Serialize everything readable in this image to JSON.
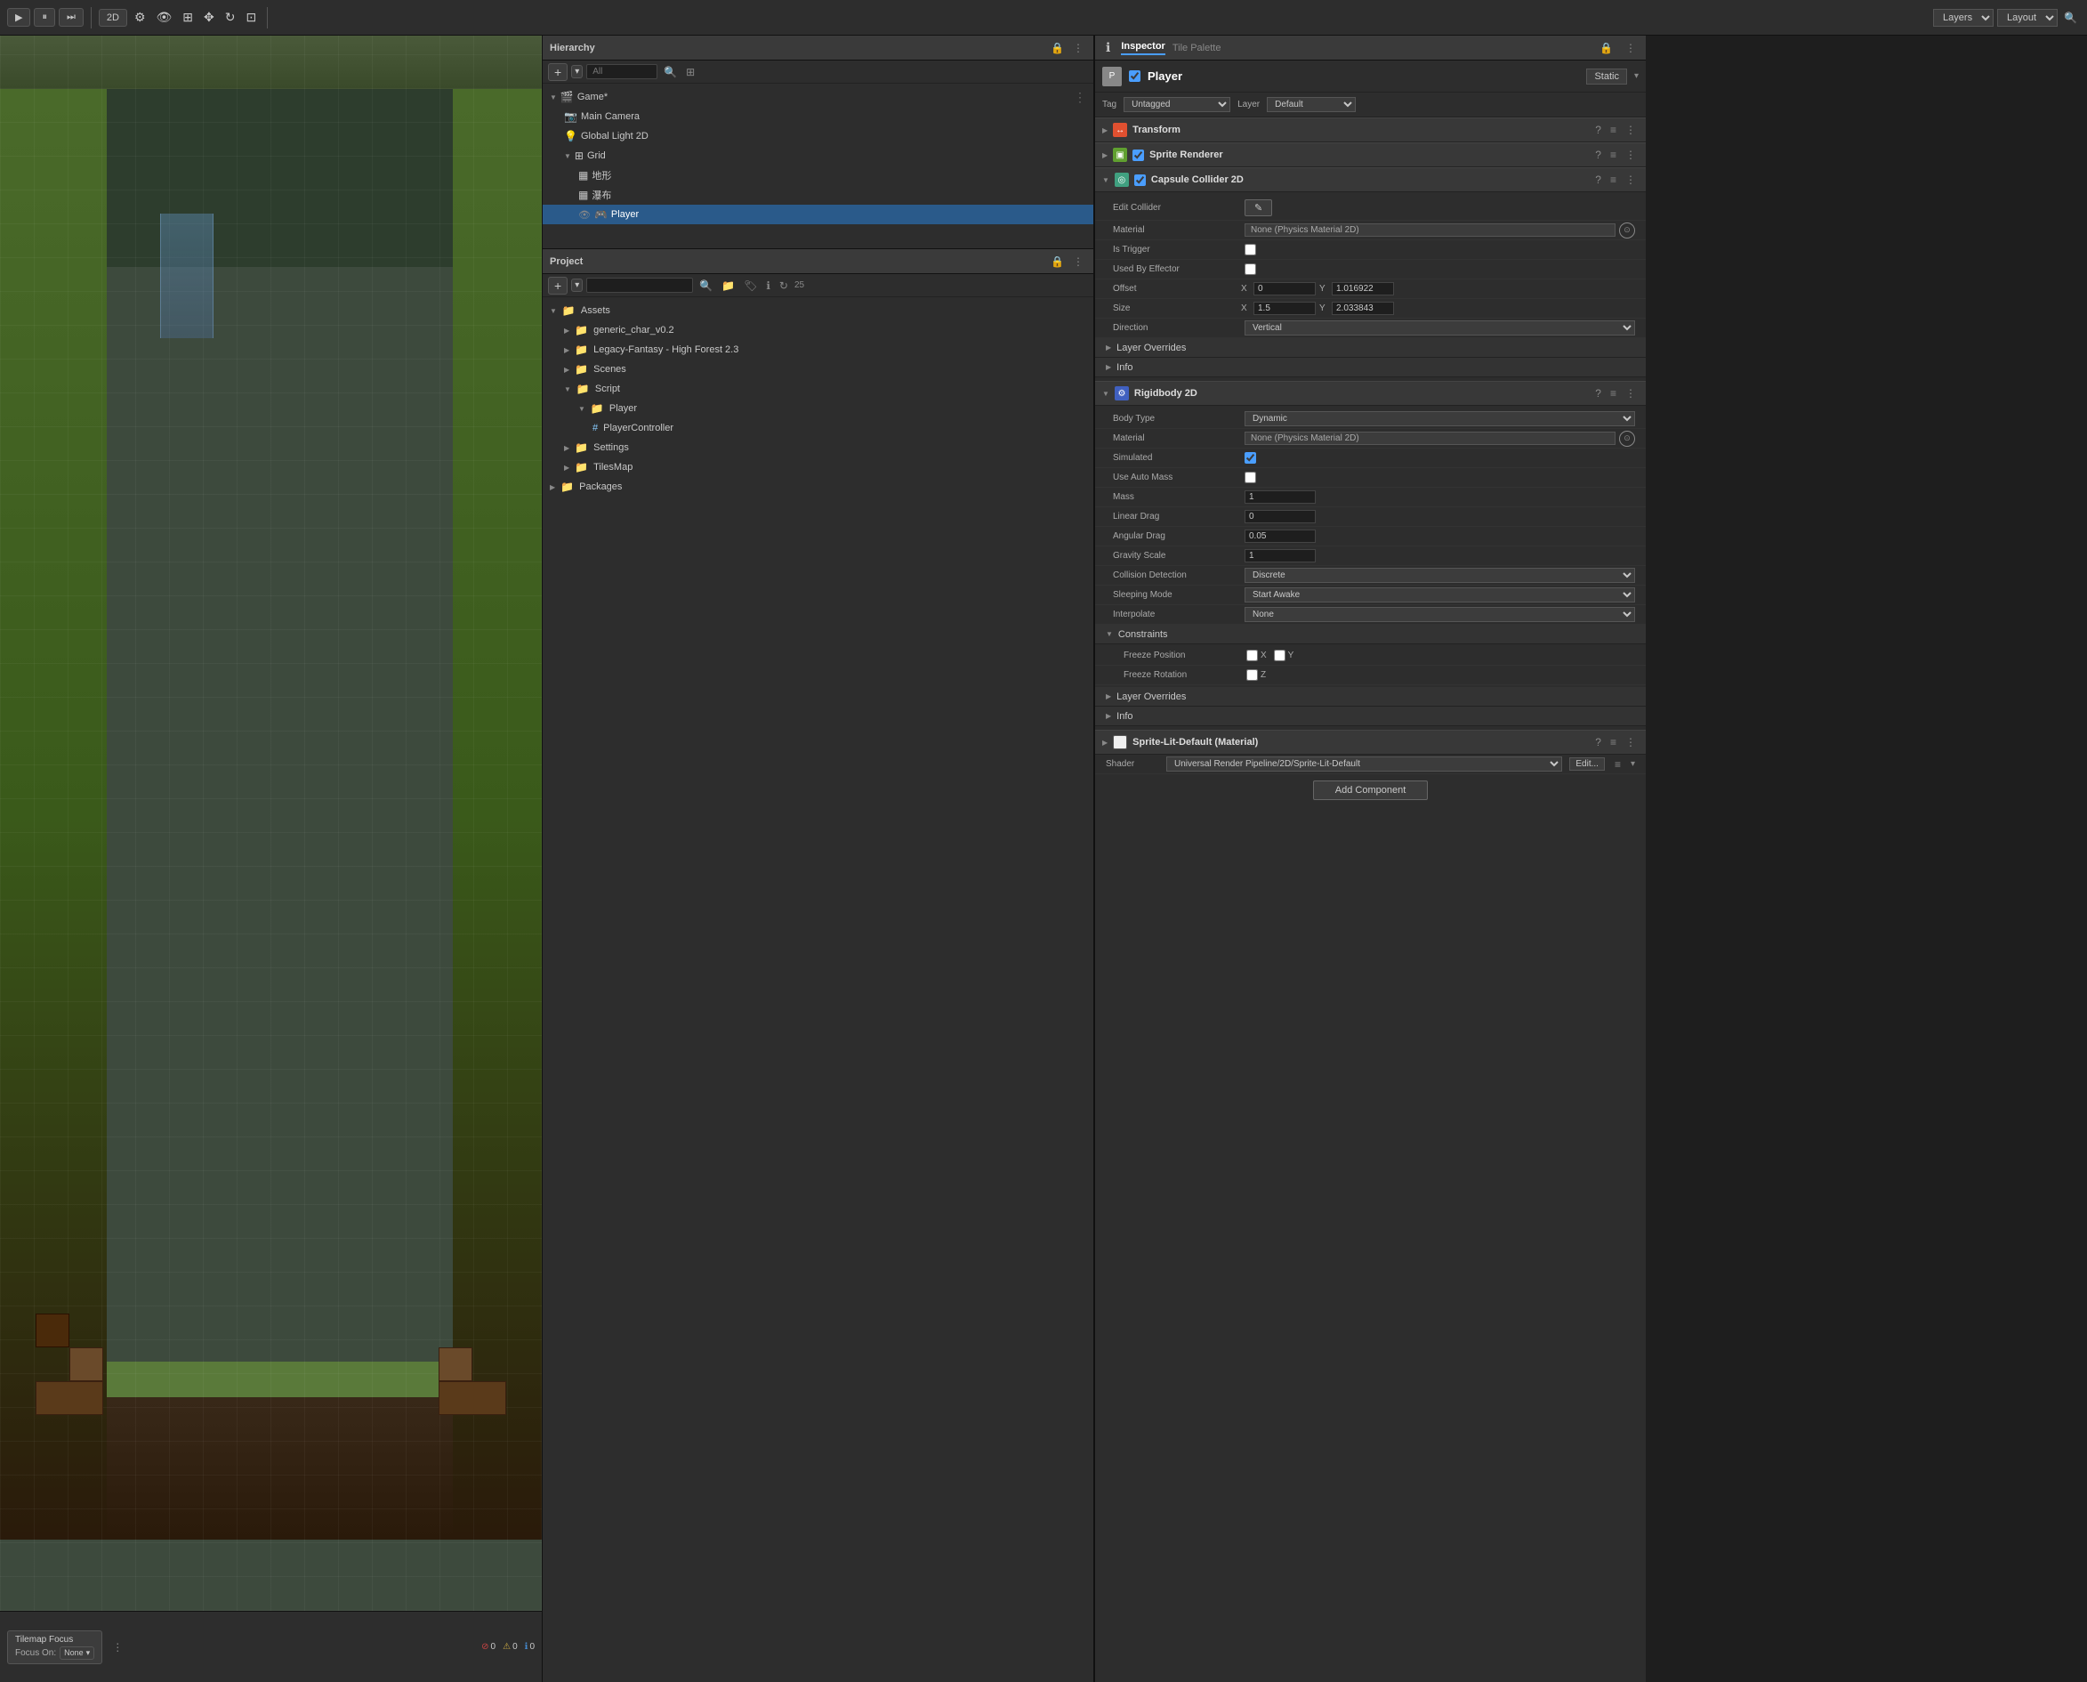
{
  "topbar": {
    "play_btn": "▶",
    "pause_btn": "⏸",
    "step_btn": "⏭",
    "more_btn": "⋮",
    "view_2d": "2D",
    "layers_label": "Layers",
    "layout_label": "Layout",
    "search_icon": "🔍"
  },
  "hierarchy": {
    "title": "Hierarchy",
    "search_placeholder": "All",
    "items": [
      {
        "label": "Game*",
        "level": 0,
        "type": "scene",
        "has_triangle": true,
        "expanded": true
      },
      {
        "label": "Main Camera",
        "level": 1,
        "type": "camera"
      },
      {
        "label": "Global Light 2D",
        "level": 1,
        "type": "light"
      },
      {
        "label": "Grid",
        "level": 1,
        "type": "grid",
        "has_triangle": true,
        "expanded": true
      },
      {
        "label": "地形",
        "level": 2,
        "type": "obj"
      },
      {
        "label": "瀑布",
        "level": 2,
        "type": "obj"
      },
      {
        "label": "Player",
        "level": 2,
        "type": "player",
        "selected": true
      }
    ]
  },
  "project": {
    "title": "Project",
    "item_count": "25",
    "items": [
      {
        "label": "Assets",
        "level": 0,
        "type": "folder",
        "expanded": true
      },
      {
        "label": "generic_char_v0.2",
        "level": 1,
        "type": "folder"
      },
      {
        "label": "Legacy-Fantasy - High Forest 2.3",
        "level": 1,
        "type": "folder"
      },
      {
        "label": "Scenes",
        "level": 1,
        "type": "folder"
      },
      {
        "label": "Script",
        "level": 1,
        "type": "folder",
        "expanded": true
      },
      {
        "label": "Player",
        "level": 2,
        "type": "folder",
        "expanded": true
      },
      {
        "label": "PlayerController",
        "level": 3,
        "type": "script"
      },
      {
        "label": "Settings",
        "level": 1,
        "type": "folder"
      },
      {
        "label": "TilesMap",
        "level": 1,
        "type": "folder"
      },
      {
        "label": "Packages",
        "level": 0,
        "type": "folder"
      }
    ]
  },
  "inspector": {
    "title": "Inspector",
    "tab_tile_palette": "Tile Palette",
    "player": {
      "name": "Player",
      "checkbox_checked": true,
      "tag_label": "Tag",
      "tag_value": "Untagged",
      "layer_label": "Layer",
      "layer_value": "Default",
      "static_label": "Static"
    },
    "transform": {
      "title": "Transform",
      "icon": "↔"
    },
    "sprite_renderer": {
      "title": "Sprite Renderer",
      "icon": "▣",
      "checkbox_checked": true
    },
    "capsule_collider": {
      "title": "Capsule Collider 2D",
      "icon": "◎",
      "checkbox_checked": true,
      "edit_collider": "Edit Collider",
      "material_label": "Material",
      "material_value": "None (Physics Material 2D)",
      "is_trigger_label": "Is Trigger",
      "used_by_effector_label": "Used By Effector",
      "offset_label": "Offset",
      "offset_x": "0",
      "offset_y": "1.016922",
      "size_label": "Size",
      "size_x": "1.5",
      "size_y": "2.033843",
      "direction_label": "Direction",
      "direction_value": "Vertical",
      "layer_overrides_label": "Layer Overrides",
      "info_label": "Info"
    },
    "rigidbody": {
      "title": "Rigidbody 2D",
      "icon": "⚙",
      "body_type_label": "Body Type",
      "body_type_value": "Dynamic",
      "material_label": "Material",
      "material_value": "None (Physics Material 2D)",
      "simulated_label": "Simulated",
      "simulated_checked": true,
      "use_auto_mass_label": "Use Auto Mass",
      "use_auto_mass_checked": false,
      "mass_label": "Mass",
      "mass_value": "1",
      "linear_drag_label": "Linear Drag",
      "linear_drag_value": "0",
      "angular_drag_label": "Angular Drag",
      "angular_drag_value": "0.05",
      "gravity_scale_label": "Gravity Scale",
      "gravity_scale_value": "1",
      "collision_detection_label": "Collision Detection",
      "collision_detection_value": "Discrete",
      "sleeping_mode_label": "Sleeping Mode",
      "sleeping_mode_value": "Start Awake",
      "interpolate_label": "Interpolate",
      "interpolate_value": "None",
      "constraints_label": "Constraints",
      "freeze_position_label": "Freeze Position",
      "freeze_position_x": false,
      "freeze_position_y": false,
      "freeze_rotation_label": "Freeze Rotation",
      "freeze_rotation_z": false,
      "layer_overrides_label": "Layer Overrides",
      "info_label": "Info"
    },
    "material_component": {
      "title": "Sprite-Lit-Default (Material)",
      "shader_label": "Shader",
      "shader_value": "Universal Render Pipeline/2D/Sprite-Lit-Default",
      "edit_label": "Edit..."
    },
    "add_component_label": "Add Component"
  },
  "status_bar": {
    "circle_count": "0",
    "warning_count": "0",
    "info_count": "0"
  },
  "tilemap_focus": {
    "title": "Tilemap Focus",
    "focus_on_label": "Focus On:",
    "focus_value": "None"
  }
}
